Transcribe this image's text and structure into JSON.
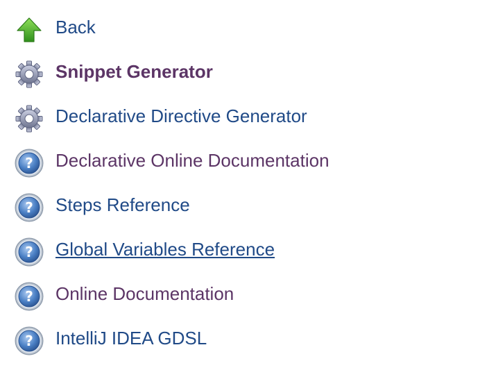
{
  "colors": {
    "link": "#204a87",
    "visited_link": "#5c3566",
    "arrow_green": "#4fae2a",
    "gear_gray": "#8a8fa8",
    "help_blue": "#3b6fb5"
  },
  "tasks": [
    {
      "label": "Back",
      "icon": "up-arrow-icon"
    },
    {
      "label": "Snippet Generator",
      "icon": "gear-icon"
    },
    {
      "label": "Declarative Directive Generator",
      "icon": "gear-icon"
    },
    {
      "label": "Declarative Online Documentation",
      "icon": "help-icon"
    },
    {
      "label": "Steps Reference",
      "icon": "help-icon"
    },
    {
      "label": "Global Variables Reference",
      "icon": "help-icon"
    },
    {
      "label": "Online Documentation",
      "icon": "help-icon"
    },
    {
      "label": "IntelliJ IDEA GDSL",
      "icon": "help-icon"
    }
  ]
}
